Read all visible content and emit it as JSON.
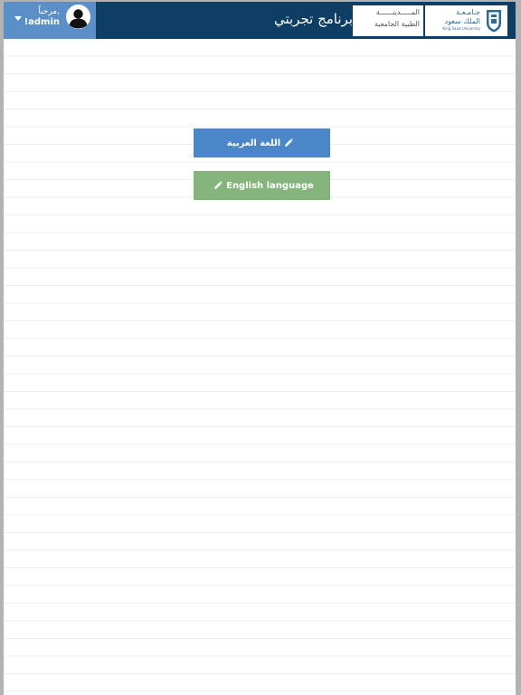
{
  "header": {
    "user": {
      "greeting": "مرحباً,",
      "username": "!admin",
      "dropdown_icon": "caret-down-icon",
      "avatar_icon": "user-avatar-icon"
    },
    "app_title": "برنامج تجربتي",
    "logo_medicine": {
      "line1": "المـــــدينــــــة",
      "line2": "الطبية الجامعية"
    },
    "logo_ksu": {
      "line1": "جـامـعـة",
      "line2": "الملك سعود",
      "line3": "King Saud University"
    }
  },
  "main": {
    "arabic_button_label": "اللغة العربية",
    "english_button_label": "English language",
    "button_icon": "pencil-icon"
  },
  "colors": {
    "header_bg": "#0e3e64",
    "user_box_bg": "#5b8fc8",
    "arabic_button_bg": "#4a86c8",
    "english_button_bg": "#84b47c"
  }
}
